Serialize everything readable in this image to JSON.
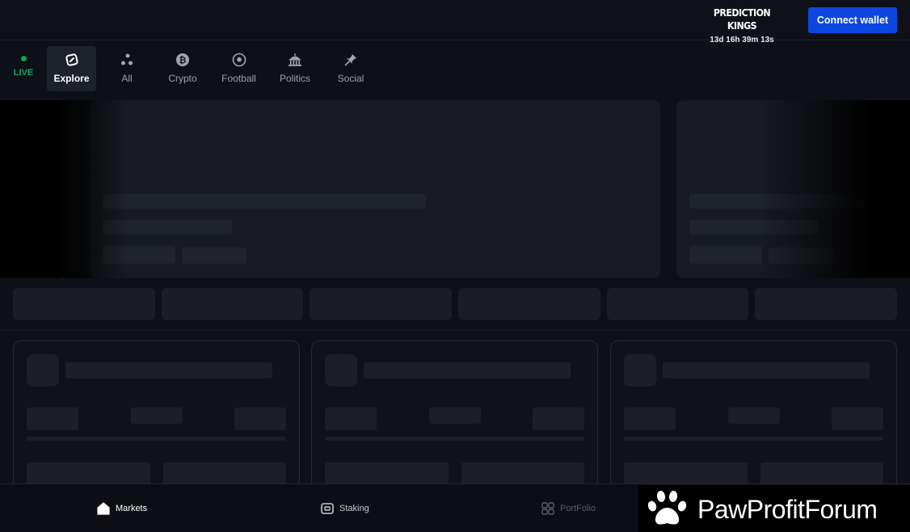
{
  "header": {
    "promo_title": "PREDICTION KINGS",
    "promo_timer": "13d 16h 39m 13s",
    "connect_label": "Connect wallet",
    "accent_color": "#0d47e0"
  },
  "categories": {
    "live_label": "LIVE",
    "live_color": "#15a864",
    "items": [
      {
        "label": "Explore",
        "icon": "explore-icon",
        "active": true
      },
      {
        "label": "All",
        "icon": "all-dots-icon",
        "active": false
      },
      {
        "label": "Crypto",
        "icon": "bitcoin-icon",
        "active": false
      },
      {
        "label": "Football",
        "icon": "football-icon",
        "active": false
      },
      {
        "label": "Politics",
        "icon": "capitol-icon",
        "active": false
      },
      {
        "label": "Social",
        "icon": "pin-icon",
        "active": false
      }
    ]
  },
  "bottom_nav": {
    "items": [
      {
        "label": "Markets",
        "icon": "home-icon",
        "active": true
      },
      {
        "label": "Staking",
        "icon": "staking-icon",
        "active": false
      },
      {
        "label": "PortFolio",
        "icon": "portfolio-icon",
        "active": false
      }
    ]
  },
  "watermark": {
    "text": "PawProfitForum",
    "icon": "paw-icon"
  }
}
